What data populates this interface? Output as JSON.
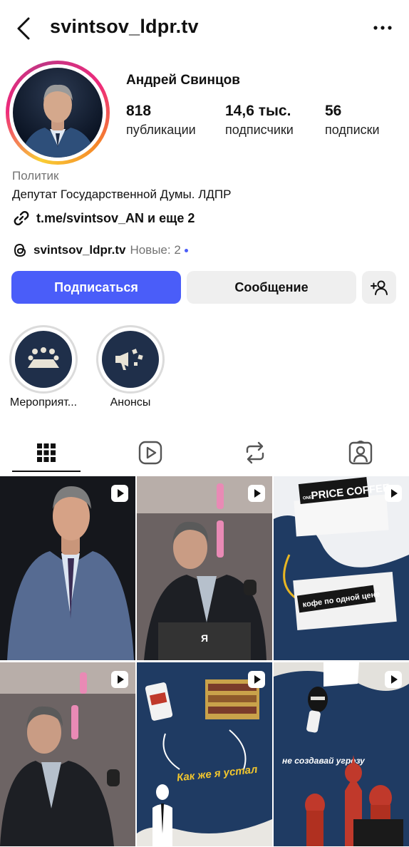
{
  "header": {
    "username": "svintsov_ldpr.tv",
    "back_icon": "back-arrow-icon",
    "more_icon": "more-horizontal-icon"
  },
  "profile": {
    "display_name": "Андрей Свинцов",
    "stats": [
      {
        "value": "818",
        "label": "публикации"
      },
      {
        "value": "14,6 тыс.",
        "label": "подписчики"
      },
      {
        "value": "56",
        "label": "подписки"
      }
    ],
    "category": "Политик",
    "bio": "Депутат Государственной Думы. ЛДПР",
    "link_text": "t.me/svintsov_AN и еще 2",
    "threads_handle": "svintsov_ldpr.tv",
    "threads_new": "Новые: 2"
  },
  "actions": {
    "follow_label": "Подписаться",
    "message_label": "Сообщение",
    "add_user_icon": "add-user-icon"
  },
  "highlights": [
    {
      "label": "Мероприят...",
      "icon": "meeting-table-icon"
    },
    {
      "label": "Анонсы",
      "icon": "megaphone-icon"
    }
  ],
  "tabs": [
    {
      "name": "posts",
      "icon": "grid-icon",
      "active": true
    },
    {
      "name": "reels",
      "icon": "reels-icon",
      "active": false
    },
    {
      "name": "reposts",
      "icon": "repost-icon",
      "active": false
    },
    {
      "name": "tagged",
      "icon": "tagged-person-icon",
      "active": false
    }
  ],
  "grid_posts": [
    {
      "type": "reel",
      "caption": ""
    },
    {
      "type": "reel",
      "caption": "Я"
    },
    {
      "type": "reel",
      "caption": "кофе по одной цене",
      "headline": "PRICE COFFEE",
      "badge": "ONE"
    },
    {
      "type": "reel",
      "caption": ""
    },
    {
      "type": "reel",
      "caption": "Как же я устал"
    },
    {
      "type": "reel",
      "caption": "не создавай угрозу"
    }
  ],
  "colors": {
    "accent": "#4a5df9",
    "secondary_button": "#efefef",
    "muted_text": "#737373",
    "highlight_bg": "#1f2f4a"
  }
}
